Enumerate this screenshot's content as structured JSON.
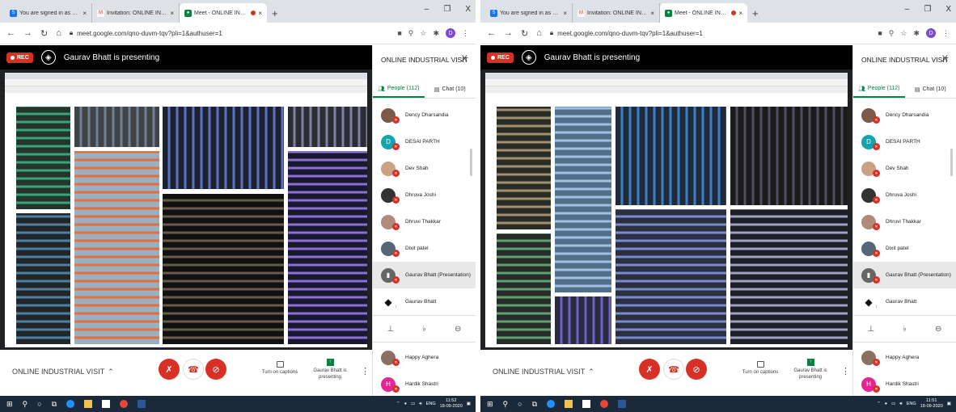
{
  "screenshots": [
    {
      "tabs": [
        {
          "label": "You are signed in as ce.dmn",
          "fav_color": "#1a73e8",
          "fav_glyph": "S"
        },
        {
          "label": "Invitation: ONLINE INDUSTRIAL",
          "fav_color": "#ffffff",
          "fav_glyph": "M"
        },
        {
          "label": "Meet - ONLINE INDUSTRIAL",
          "fav_color": "#0b8043",
          "fav_glyph": "●"
        }
      ],
      "new_tab": "+",
      "window_controls": [
        "–",
        "❐",
        "X"
      ],
      "address_url": "meet.google.com/qno-duvm-tqv?pli=1&authuser=1",
      "profile_initial": "D",
      "presenter": {
        "rec_label": "REC",
        "text": "Gaurav Bhatt is presenting"
      },
      "panel": {
        "title": "ONLINE INDUSTRIAL VISIT",
        "close": "X",
        "tab_people": "People (112)",
        "tab_chat": "Chat (10)",
        "participants": [
          {
            "name": "Dency Dharsandia",
            "color": "#7b5a4a",
            "initial": ""
          },
          {
            "name": "DESAI PARTH",
            "color": "#12a4af",
            "initial": "D"
          },
          {
            "name": "Dev Shah",
            "color": "#c9a184",
            "initial": ""
          },
          {
            "name": "Dhruva Joshi",
            "color": "#333333",
            "initial": ""
          },
          {
            "name": "Dhruvi Thakkar",
            "color": "#b08a7a",
            "initial": ""
          },
          {
            "name": "Dixit patel",
            "color": "#556677",
            "initial": ""
          },
          {
            "name": "Gaurav Bhatt (Presentation)",
            "color": "#666666",
            "initial": "▮"
          },
          {
            "name": "Gaurav Bhatt",
            "color": "#ffffff",
            "initial": "◆"
          }
        ],
        "participants_after": [
          {
            "name": "Happy Aghera",
            "color": "#8a7060",
            "initial": ""
          },
          {
            "name": "Hardik Shastri",
            "color": "#e52592",
            "initial": "H"
          }
        ]
      },
      "bottom": {
        "meeting_title": "ONLINE INDUSTRIAL VISIT",
        "captions_label": "Turn on captions",
        "presenting_label": "Gaurav Bhatt is presenting"
      },
      "taskbar": {
        "lang": "ENG",
        "time": "11:52",
        "date": "18-09-2020"
      }
    },
    {
      "tabs": [
        {
          "label": "You are signed in as ce.dmn",
          "fav_color": "#1a73e8",
          "fav_glyph": "S"
        },
        {
          "label": "Invitation: ONLINE INDUSTRIAL",
          "fav_color": "#ffffff",
          "fav_glyph": "M"
        },
        {
          "label": "Meet - ONLINE INDUSTRIAL",
          "fav_color": "#0b8043",
          "fav_glyph": "●"
        }
      ],
      "new_tab": "+",
      "window_controls": [
        "–",
        "❐",
        "X"
      ],
      "address_url": "meet.google.com/qno-duvm-tqv?pli=1&authuser=1",
      "profile_initial": "D",
      "presenter": {
        "rec_label": "REC",
        "text": "Gaurav Bhatt is presenting"
      },
      "panel": {
        "title": "ONLINE INDUSTRIAL VISIT",
        "close": "X",
        "tab_people": "People (112)",
        "tab_chat": "Chat (10)",
        "participants": [
          {
            "name": "Dency Dharsandia",
            "color": "#7b5a4a",
            "initial": ""
          },
          {
            "name": "DESAI PARTH",
            "color": "#12a4af",
            "initial": "D"
          },
          {
            "name": "Dev Shah",
            "color": "#c9a184",
            "initial": ""
          },
          {
            "name": "Dhruva Joshi",
            "color": "#333333",
            "initial": ""
          },
          {
            "name": "Dhruvi Thakkar",
            "color": "#b08a7a",
            "initial": ""
          },
          {
            "name": "Dixit patel",
            "color": "#556677",
            "initial": ""
          },
          {
            "name": "Gaurav Bhatt (Presentation)",
            "color": "#666666",
            "initial": "▮"
          },
          {
            "name": "Gaurav Bhatt",
            "color": "#ffffff",
            "initial": "◆"
          }
        ],
        "participants_after": [
          {
            "name": "Happy Aghera",
            "color": "#8a7060",
            "initial": ""
          },
          {
            "name": "Hardik Shastri",
            "color": "#e52592",
            "initial": "H"
          }
        ]
      },
      "bottom": {
        "meeting_title": "ONLINE INDUSTRIAL VISIT",
        "captions_label": "Turn on captions",
        "presenting_label": "Gaurav Bhatt is presenting"
      },
      "taskbar": {
        "lang": "ENG",
        "time": "11:51",
        "date": "18-09-2020"
      }
    }
  ],
  "colors": {
    "red": "#d93025",
    "green": "#0b8043",
    "presenter_bar": "#000000",
    "taskbar": "#1b2a3a"
  }
}
